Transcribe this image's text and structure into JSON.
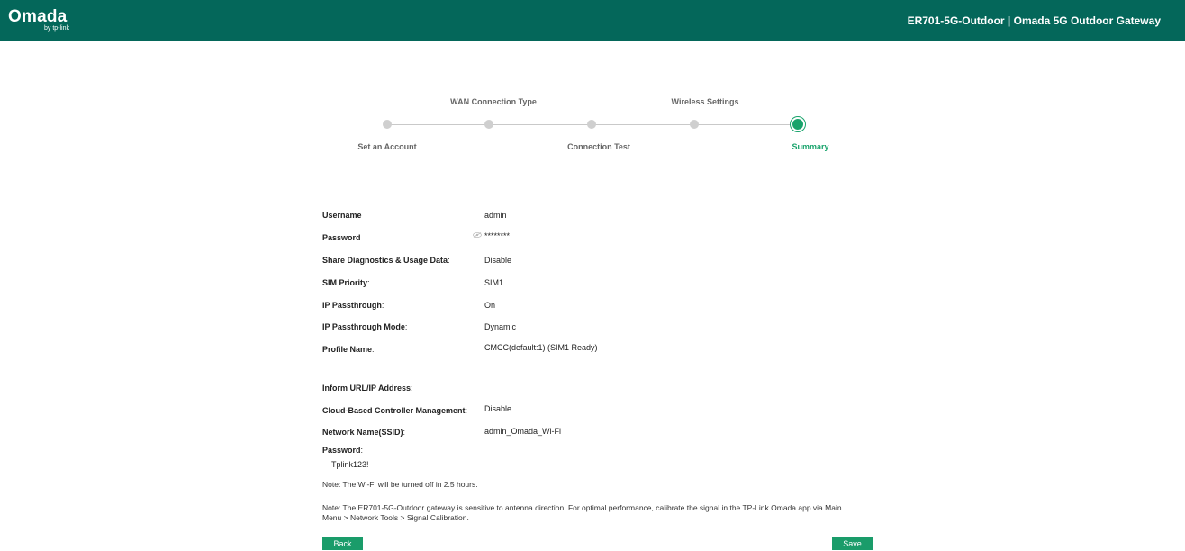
{
  "header": {
    "logo": "Omada",
    "logo_sub": "by tp-link",
    "device_info": "ER701-5G-Outdoor  |  Omada 5G Outdoor Gateway"
  },
  "steps": [
    {
      "label": "Set an Account",
      "active": false
    },
    {
      "label": "WAN Connection Type",
      "active": false
    },
    {
      "label": "Connection Test",
      "active": false
    },
    {
      "label": "Wireless Settings",
      "active": false
    },
    {
      "label": "Summary",
      "active": true
    }
  ],
  "summary": {
    "username": {
      "label": "Username",
      "value": "admin"
    },
    "password": {
      "label": "Password",
      "value": "********"
    },
    "share_diag": {
      "label": "Share Diagnostics & Usage Data",
      "value": "Disable"
    },
    "sim_priority": {
      "label": "SIM Priority",
      "value": "SIM1"
    },
    "ip_passthrough": {
      "label": "IP Passthrough",
      "value": "On"
    },
    "ip_passthrough_mode": {
      "label": "IP Passthrough Mode",
      "value": "Dynamic"
    },
    "profile_name": {
      "label": "Profile Name",
      "value": "CMCC(default:1) (SIM1 Ready)"
    },
    "inform_url": {
      "label": "Inform URL/IP Address",
      "value": ""
    },
    "cloud_mgmt": {
      "label": "Cloud-Based Controller Management",
      "value": "Disable"
    },
    "ssid": {
      "label": "Network Name(SSID)",
      "value": "admin_Omada_Wi-Fi"
    },
    "wifi_password": {
      "label": "Password",
      "value": "Tplink123!"
    }
  },
  "notes": {
    "wifi_off": "Note: The Wi-Fi will be turned off in 2.5 hours.",
    "antenna_line1": "Note: The ER701-5G-Outdoor gateway is sensitive to antenna direction. For optimal performance, calibrate the signal in the TP-Link Omada app via Main",
    "antenna_line2": "Menu > Network Tools > Signal Calibration."
  },
  "buttons": {
    "back": "Back",
    "save": "Save"
  },
  "colors": {
    "header_bg": "#04675a",
    "accent": "#18a36b",
    "button": "#1a9c6a"
  }
}
